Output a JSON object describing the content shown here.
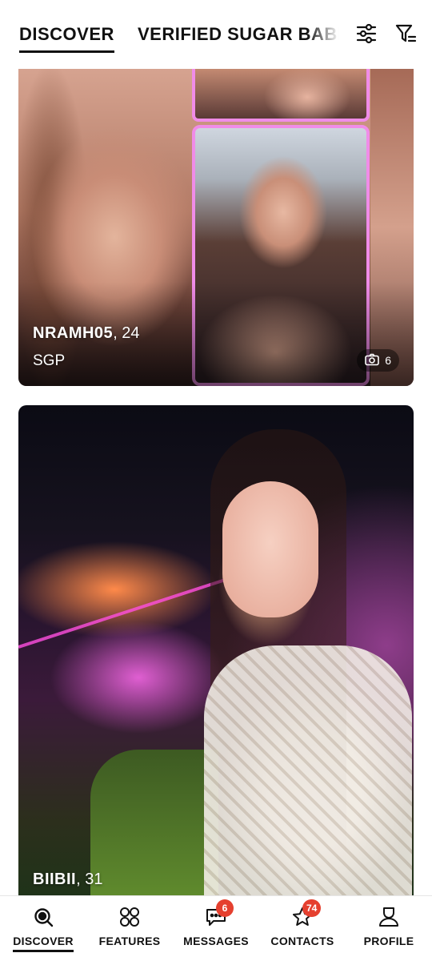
{
  "top_tabs": {
    "active": "DISCOVER",
    "other": "VERIFIED SUGAR BABIES"
  },
  "top_icons": [
    "sliders-icon",
    "filter-icon"
  ],
  "profiles": [
    {
      "name": "NRAMH05",
      "age": ", 24",
      "location": "SGP",
      "photo_count": "6"
    },
    {
      "name": "BIIBII",
      "age": ", 31"
    }
  ],
  "bottom_nav": {
    "items": [
      {
        "label": "DISCOVER",
        "icon": "search-icon"
      },
      {
        "label": "FEATURES",
        "icon": "grid-icon"
      },
      {
        "label": "MESSAGES",
        "icon": "chat-icon",
        "badge": "6"
      },
      {
        "label": "CONTACTS",
        "icon": "star-icon",
        "badge": "74"
      },
      {
        "label": "PROFILE",
        "icon": "person-icon"
      }
    ]
  },
  "colors": {
    "accent_badge": "#e5402f",
    "photo_frame": "#f08ce8"
  }
}
